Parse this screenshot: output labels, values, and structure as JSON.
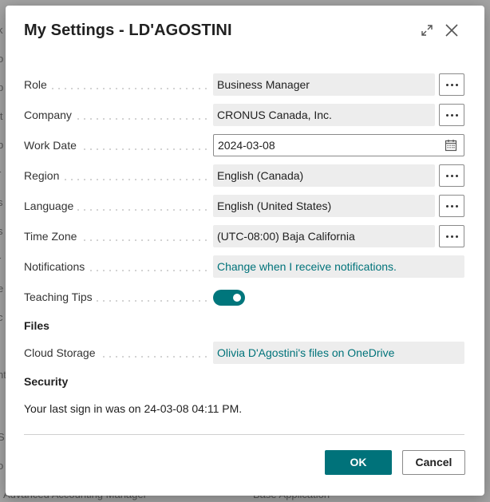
{
  "background": {
    "top_text": "",
    "bottom_left": "Advanced Accounting Manager",
    "bottom_right": "Base Application",
    "left_chars": [
      "k",
      "o",
      "p",
      "it",
      "b",
      "r",
      "s",
      "s",
      "r",
      "e",
      "c",
      "nt",
      "S",
      "o"
    ]
  },
  "dialog": {
    "title": "My Settings - LD'AGOSTINI",
    "fields": {
      "role": {
        "label": "Role",
        "value": "Business Manager"
      },
      "company": {
        "label": "Company",
        "value": "CRONUS Canada, Inc."
      },
      "work_date": {
        "label": "Work Date",
        "value": "2024-03-08"
      },
      "region": {
        "label": "Region",
        "value": "English (Canada)"
      },
      "language": {
        "label": "Language",
        "value": "English (United States)"
      },
      "time_zone": {
        "label": "Time Zone",
        "value": "(UTC-08:00) Baja California"
      },
      "notifications": {
        "label": "Notifications",
        "value": "Change when I receive notifications."
      },
      "teaching_tips": {
        "label": "Teaching Tips",
        "enabled": true
      }
    },
    "files": {
      "heading": "Files",
      "cloud_storage": {
        "label": "Cloud Storage",
        "value": "Olivia D'Agostini's files on OneDrive"
      }
    },
    "security": {
      "heading": "Security",
      "last_sign_in": "Your last sign in was on 24-03-08 04:11 PM."
    },
    "buttons": {
      "ok": "OK",
      "cancel": "Cancel"
    }
  },
  "colors": {
    "accent": "#00727a",
    "field_bg": "#ededed"
  }
}
